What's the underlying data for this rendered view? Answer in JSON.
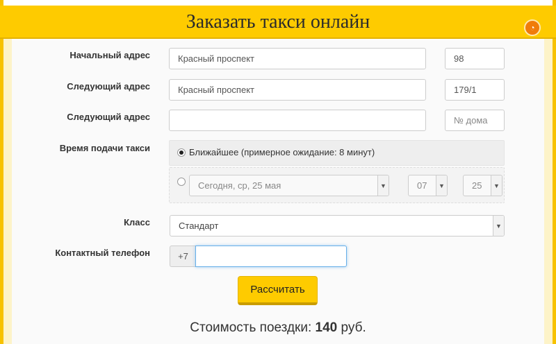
{
  "header": {
    "title": "Заказать такси онлайн",
    "logo_icon": "taxi-logo-icon"
  },
  "form": {
    "start": {
      "label": "Начальный адрес",
      "street_value": "Красный проспект",
      "house_value": "98"
    },
    "next1": {
      "label": "Следующий адрес",
      "street_value": "Красный проспект",
      "house_value": "179/1"
    },
    "next2": {
      "label": "Следующий адрес",
      "street_value": "",
      "house_placeholder": "№ дома"
    },
    "time": {
      "label": "Время подачи такси",
      "nearest_label": "Ближайшее (примерное ожидание: 8 минут)",
      "date_value": "Сегодня, ср, 25 мая",
      "hour_value": "07",
      "minute_value": "25"
    },
    "class": {
      "label": "Класс",
      "value": "Стандарт"
    },
    "phone": {
      "label": "Контактный телефон",
      "prefix": "+7",
      "value": ""
    },
    "calculate_label": "Рассчитать"
  },
  "price": {
    "prefix": "Стоимость поездки:",
    "amount": "140",
    "currency": "руб."
  },
  "colors": {
    "accent": "#fecb00",
    "logo": "#f07c0a"
  }
}
